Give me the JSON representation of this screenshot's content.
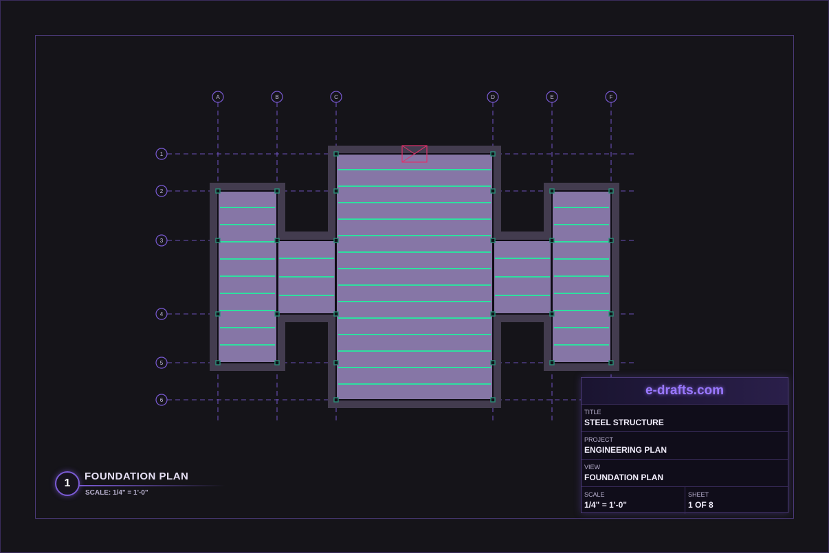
{
  "grid": {
    "columns": [
      "A",
      "B",
      "C",
      "D",
      "E",
      "F"
    ],
    "rows": [
      "1",
      "2",
      "3",
      "4",
      "5",
      "6"
    ]
  },
  "view_label": {
    "number": "1",
    "title": "FOUNDATION PLAN",
    "scale": "SCALE: 1/4\" = 1'-0\""
  },
  "title_block": {
    "logo": "e-drafts.com",
    "title_label": "TITLE",
    "title_value": "STEEL STRUCTURE",
    "project_label": "PROJECT",
    "project_value": "ENGINEERING PLAN",
    "view_label": "VIEW",
    "view_value": "FOUNDATION PLAN",
    "scale_label": "SCALE",
    "scale_value": "1/4\" = 1'-0\"",
    "sheet_label": "SHEET",
    "sheet_value": "1 OF 8"
  },
  "colors": {
    "background": "#151419",
    "accent": "#7b5bd6",
    "slab": "#8676a6",
    "slab_border": "#433c4f",
    "joist": "#2ee0a0",
    "column": "#2a8f78",
    "opening": "#e0306a"
  }
}
